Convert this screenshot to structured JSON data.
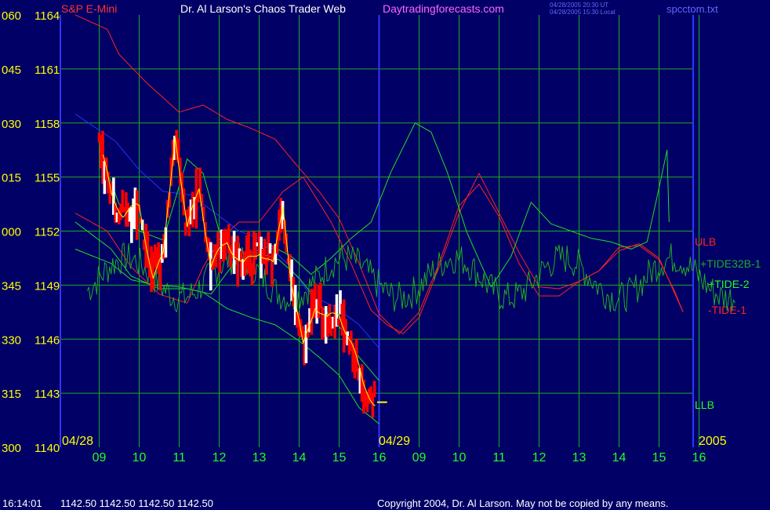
{
  "header": {
    "instrument": "S&P E-Mini",
    "title": "Dr. Al Larson's Chaos Trader Web",
    "site": "Daytradingforecasts.com",
    "stamp_ut": "04/28/2005 20:30 UT",
    "stamp_local": "04/28/2005 15:30 Local",
    "file": "spcctom.txt"
  },
  "colors": {
    "background": "#000066",
    "grid": "#22aa22",
    "axis": "#3333ff",
    "price_up": "#ffffff",
    "price_down": "#ff0000",
    "smooth": "#ffff00",
    "red_line": "#ff2222",
    "green_line": "#22dd22",
    "dark_green": "#22aa22",
    "blue_line": "#2233ff",
    "axis_text": "#ffff00",
    "time_text": "#22ff22",
    "instrument_text": "#ff3333",
    "title_text": "#ffffff",
    "site_text": "#ff66ff",
    "stamp_text": "#6666ff"
  },
  "chart_data": {
    "type": "line",
    "title": "S&P E-Mini",
    "y_prices": [
      "1164",
      "1161",
      "1158",
      "1155",
      "1152",
      "1149",
      "1146",
      "1143",
      "1140"
    ],
    "y_angles": [
      "060",
      "045",
      "030",
      "015",
      "000",
      "345",
      "330",
      "315",
      "300"
    ],
    "ylim": [
      1140,
      1164
    ],
    "date_labels": [
      "04/28",
      "04/29",
      "2005"
    ],
    "hour_labels": [
      "09",
      "10",
      "11",
      "12",
      "13",
      "14",
      "15",
      "16",
      "09",
      "10",
      "11",
      "12",
      "13",
      "14",
      "15",
      "16"
    ],
    "band_labels": [
      {
        "text": "ULB",
        "color": "#ff2222"
      },
      {
        "text": "+TIDE32B-1",
        "color": "#22aa22"
      },
      {
        "text": "+TIDE-2",
        "color": "#22ff22"
      },
      {
        "text": "-TIDE-1",
        "color": "#ff2222"
      },
      {
        "text": "LLB",
        "color": "#22ff22"
      }
    ],
    "price_key": [
      {
        "x": 0,
        "y": 1157
      },
      {
        "x": 0.3,
        "y": 1154
      },
      {
        "x": 0.6,
        "y": 1153
      },
      {
        "x": 1.0,
        "y": 1153.3
      },
      {
        "x": 1.35,
        "y": 1149.5
      },
      {
        "x": 1.6,
        "y": 1150.5
      },
      {
        "x": 1.9,
        "y": 1157.5
      },
      {
        "x": 2.2,
        "y": 1152
      },
      {
        "x": 2.5,
        "y": 1154.5
      },
      {
        "x": 2.8,
        "y": 1150
      },
      {
        "x": 3.2,
        "y": 1151.5
      },
      {
        "x": 3.6,
        "y": 1150
      },
      {
        "x": 4.0,
        "y": 1151
      },
      {
        "x": 4.35,
        "y": 1150
      },
      {
        "x": 4.6,
        "y": 1153.5
      },
      {
        "x": 4.8,
        "y": 1149.3
      },
      {
        "x": 5.1,
        "y": 1145.5
      },
      {
        "x": 5.4,
        "y": 1148
      },
      {
        "x": 5.7,
        "y": 1147
      },
      {
        "x": 6.0,
        "y": 1147.5
      },
      {
        "x": 6.3,
        "y": 1145.8
      },
      {
        "x": 6.6,
        "y": 1143.5
      },
      {
        "x": 6.9,
        "y": 1142.5
      }
    ],
    "last_price": 1142.5,
    "ulb": [
      [
        -0.6,
        1164
      ],
      [
        0.2,
        1163.2
      ],
      [
        0.5,
        1161.8
      ],
      [
        1.2,
        1160.2
      ],
      [
        2.0,
        1158.6
      ],
      [
        2.6,
        1159.0
      ],
      [
        3.2,
        1158.2
      ],
      [
        3.8,
        1157.7
      ],
      [
        4.4,
        1157.1
      ],
      [
        5.0,
        1155.5
      ],
      [
        5.5,
        1154.2
      ],
      [
        6.0,
        1152.7
      ],
      [
        6.5,
        1150.2
      ],
      [
        7.0,
        1147.4
      ],
      [
        7.5,
        1146.3
      ],
      [
        8.0,
        1147.5
      ],
      [
        8.5,
        1150.2
      ],
      [
        9.0,
        1153.4
      ],
      [
        9.5,
        1154.6
      ],
      [
        10.0,
        1152.8
      ],
      [
        10.5,
        1150.2
      ],
      [
        11.0,
        1148.4
      ],
      [
        11.5,
        1148.4
      ],
      [
        12.0,
        1149.2
      ],
      [
        12.5,
        1149.8
      ],
      [
        13.0,
        1151.1
      ],
      [
        13.5,
        1151.2
      ],
      [
        14.0,
        1150.4
      ],
      [
        14.4,
        1148.6
      ],
      [
        14.6,
        1147.5
      ]
    ],
    "tide2_green": [
      [
        -0.6,
        1152.5
      ],
      [
        0.3,
        1151
      ],
      [
        0.8,
        1149.5
      ],
      [
        1.5,
        1148.8
      ],
      [
        2.2,
        1148.8
      ],
      [
        2.8,
        1148.5
      ],
      [
        3.3,
        1150.0
      ],
      [
        3.8,
        1150.8
      ],
      [
        4.3,
        1151.2
      ],
      [
        4.8,
        1150.6
      ],
      [
        5.3,
        1149.6
      ],
      [
        5.8,
        1150.5
      ],
      [
        6.3,
        1151.6
      ],
      [
        6.8,
        1152.5
      ],
      [
        7.3,
        1155.3
      ],
      [
        7.9,
        1158.0
      ],
      [
        8.3,
        1157.5
      ],
      [
        8.7,
        1155.3
      ],
      [
        9.2,
        1151.9
      ],
      [
        9.8,
        1148.9
      ],
      [
        10.3,
        1150.6
      ],
      [
        10.8,
        1153.6
      ],
      [
        11.3,
        1152.4
      ],
      [
        11.8,
        1152.0
      ],
      [
        12.3,
        1151.6
      ],
      [
        12.8,
        1151.4
      ],
      [
        13.3,
        1151.0
      ],
      [
        13.7,
        1151.4
      ],
      [
        14.0,
        1154.4
      ],
      [
        14.2,
        1156.5
      ],
      [
        14.25,
        1152.5
      ]
    ],
    "tide1_red": [
      [
        -0.6,
        1153
      ],
      [
        0.2,
        1152
      ],
      [
        0.8,
        1150
      ],
      [
        1.5,
        1148.5
      ],
      [
        2.2,
        1148
      ],
      [
        2.6,
        1150
      ],
      [
        3.0,
        1151.5
      ],
      [
        3.5,
        1152.5
      ],
      [
        4.0,
        1152.5
      ],
      [
        4.6,
        1154.2
      ],
      [
        5.1,
        1155.0
      ],
      [
        5.8,
        1152.5
      ],
      [
        6.3,
        1150.2
      ],
      [
        6.8,
        1147.6
      ],
      [
        7.2,
        1146.8
      ],
      [
        7.6,
        1146.3
      ],
      [
        8.0,
        1147.2
      ],
      [
        8.5,
        1150.0
      ],
      [
        9.0,
        1153.0
      ],
      [
        9.5,
        1155.2
      ],
      [
        10.0,
        1153.0
      ],
      [
        10.5,
        1150.8
      ],
      [
        11.0,
        1148.9
      ],
      [
        11.5,
        1148.8
      ],
      [
        12.0,
        1149.2
      ],
      [
        12.5,
        1149.8
      ],
      [
        13.0,
        1150.9
      ],
      [
        13.5,
        1151.3
      ],
      [
        14.0,
        1150.5
      ],
      [
        14.3,
        1149.0
      ],
      [
        14.6,
        1147.5
      ]
    ],
    "llb": [
      [
        -0.6,
        1151
      ],
      [
        0.3,
        1150.2
      ],
      [
        0.8,
        1149.3
      ],
      [
        1.4,
        1149.0
      ],
      [
        2.0,
        1148.9
      ],
      [
        2.6,
        1148.6
      ],
      [
        3.2,
        1147.7
      ],
      [
        3.8,
        1147.2
      ],
      [
        4.4,
        1146.8
      ],
      [
        5.0,
        1145.9
      ],
      [
        5.5,
        1145.0
      ],
      [
        6.0,
        1144.0
      ],
      [
        6.5,
        1142.2
      ],
      [
        7.0,
        1141.3
      ]
    ],
    "blue_band": [
      [
        -0.6,
        1158.5
      ],
      [
        0.4,
        1157
      ],
      [
        1.0,
        1155.4
      ],
      [
        1.6,
        1154.2
      ],
      [
        2.3,
        1154.0
      ],
      [
        2.9,
        1153.0
      ],
      [
        3.5,
        1152.0
      ],
      [
        4.1,
        1151.5
      ],
      [
        4.7,
        1150.2
      ],
      [
        5.3,
        1148.4
      ],
      [
        5.9,
        1147.8
      ],
      [
        6.5,
        1146.8
      ],
      [
        7.0,
        1145.5
      ]
    ],
    "green_upper": [
      [
        0,
        1156.5
      ],
      [
        0.5,
        1153.5
      ],
      [
        1.0,
        1152
      ],
      [
        1.6,
        1151.5
      ],
      [
        2.2,
        1156
      ],
      [
        2.6,
        1155.2
      ],
      [
        3.0,
        1152
      ],
      [
        3.5,
        1150.5
      ],
      [
        4.0,
        1150.8
      ],
      [
        4.5,
        1150.4
      ],
      [
        5.0,
        1149.4
      ],
      [
        5.5,
        1148.0
      ],
      [
        6.0,
        1146.7
      ],
      [
        6.5,
        1145.0
      ],
      [
        7.0,
        1143.7
      ]
    ],
    "tide32_center": 1149.4
  },
  "footer": {
    "time": "16:14:01",
    "quotes": "1142.50 1142.50 1142.50 1142.50",
    "copyright": "Copyright 2004, Dr. Al Larson. May not be copied by any means."
  }
}
